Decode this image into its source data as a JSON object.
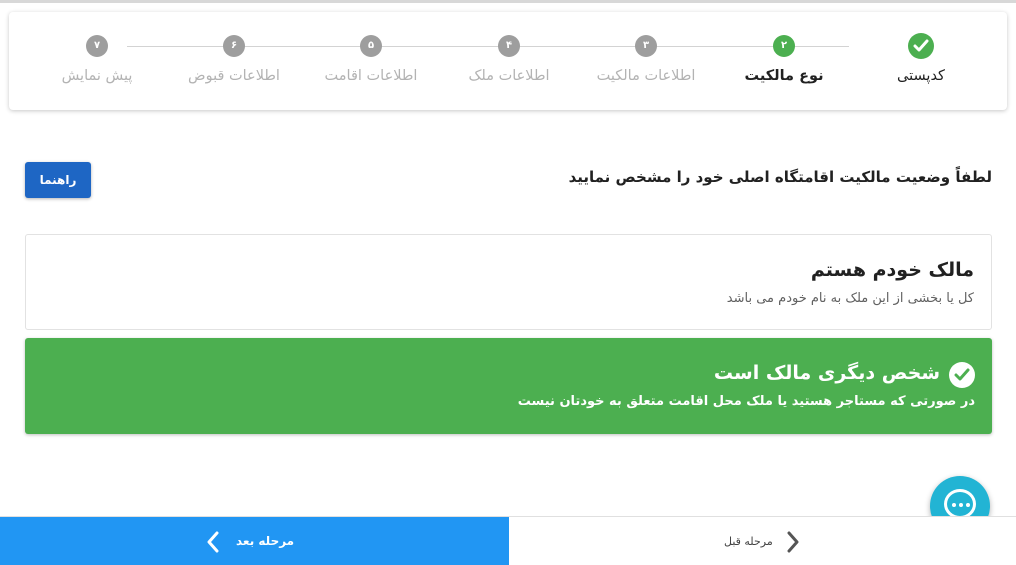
{
  "stepper": {
    "steps": [
      {
        "number": "",
        "label": "کدپستی",
        "state": "done"
      },
      {
        "number": "۲",
        "label": "نوع مالکیت",
        "state": "active"
      },
      {
        "number": "۳",
        "label": "اطلاعات مالکیت",
        "state": "pending"
      },
      {
        "number": "۴",
        "label": "اطلاعات ملک",
        "state": "pending"
      },
      {
        "number": "۵",
        "label": "اطلاعات اقامت",
        "state": "pending"
      },
      {
        "number": "۶",
        "label": "اطلاعات قبوض",
        "state": "pending"
      },
      {
        "number": "۷",
        "label": "پیش نمایش",
        "state": "pending"
      }
    ]
  },
  "instruction": "لطفاً وضعیت مالکیت اقامتگاه اصلی خود را مشخص نمایید",
  "guide_button": "راهنما",
  "options": {
    "owner": {
      "title": "مالک خودم هستم",
      "description": "کل یا بخشی از این ملک به نام خودم می باشد",
      "selected": false
    },
    "other": {
      "title": "شخص دیگری مالک است",
      "description": "در صورتی که مستاجر هستید یا ملک محل اقامت متعلق به خودتان نیست",
      "selected": true
    }
  },
  "navigation": {
    "next_label": "مرحله بعد",
    "prev_label": "مرحله قبل"
  },
  "colors": {
    "success": "#4caf50",
    "primary": "#2196f3",
    "guide": "#1e66c4",
    "chat": "#22b4d4"
  },
  "icons": {
    "step_done": "check-icon",
    "chat": "chat-icon",
    "next": "chevron-left-icon",
    "prev": "chevron-right-icon"
  }
}
